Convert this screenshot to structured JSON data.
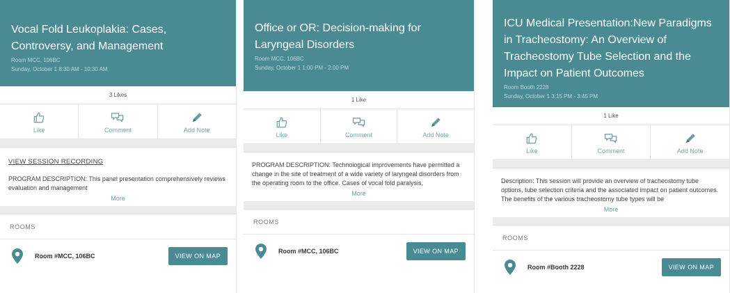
{
  "cards": [
    {
      "title": "Vocal Fold Leukoplakia: Cases, Controversy, and Management",
      "room": "Room MCC, 106BC",
      "datetime": "Sunday, October 1 8:30 AM - 10:30 AM",
      "likes": "3 Likes",
      "actions": {
        "like": "Like",
        "comment": "Comment",
        "note": "Add Note"
      },
      "recording_link": "VIEW SESSION RECORDING",
      "description": "PROGRAM DESCRIPTION: This panel presentation comprehensively reviews evaluation and management",
      "more": "More",
      "rooms_label": "ROOMS",
      "room_name": "Room #MCC, 106BC",
      "map_button": "VIEW ON MAP"
    },
    {
      "title": "Office or OR: Decision-making for Laryngeal Disorders",
      "room": "Room MCC, 106BC",
      "datetime": "Sunday, October 1 1:00 PM - 2:00 PM",
      "likes": "1 Like",
      "actions": {
        "like": "Like",
        "comment": "Comment",
        "note": "Add Note"
      },
      "description": "PROGRAM DESCRIPTION: Technological improvements have permitted a change in the site of treatment of a wide variety of laryngeal disorders from the operating room to the office. Cases of vocal fold paralysis,",
      "more": "More",
      "rooms_label": "ROOMS",
      "room_name": "Room #MCC, 106BC",
      "map_button": "VIEW ON MAP"
    },
    {
      "title": "ICU Medical Presentation:New Paradigms in Tracheostomy: An Overview of Tracheostomy Tube Selection and the Impact on Patient Outcomes",
      "room": "Room Booth 2228",
      "datetime": "Sunday, October 1 3:15 PM - 3:45 PM",
      "likes": "1 Like",
      "actions": {
        "like": "Like",
        "comment": "Comment",
        "note": "Add Note"
      },
      "description": "Description: This session will provide an overview of tracheostomy tube options, tube selection criteria and the associated impact on patient outcomes. The benefits of the various tracheostomy tube types will be",
      "more": "More",
      "rooms_label": "ROOMS",
      "room_name": "Room #Booth 2228",
      "map_button": "VIEW ON MAP"
    }
  ],
  "icons": {
    "like": "thumbs-up-icon",
    "comment": "comment-bubbles-icon",
    "note": "pencil-icon",
    "room": "map-pin-icon"
  },
  "colors": {
    "header": "#4a8b93",
    "accent": "#6a9ba1",
    "button": "#4a8b93"
  }
}
